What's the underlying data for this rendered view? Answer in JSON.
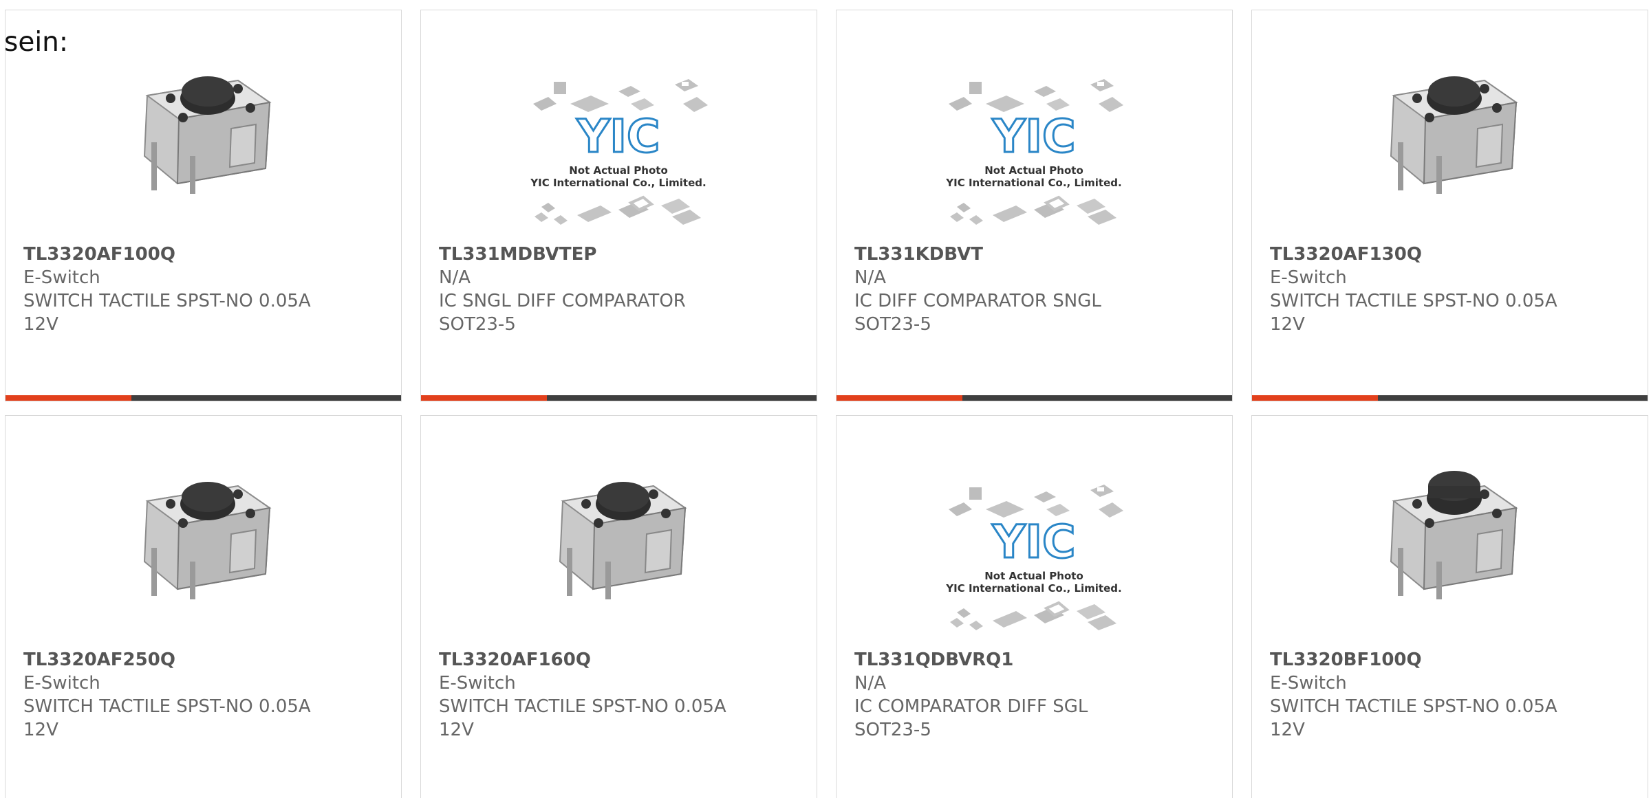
{
  "intro_text": "sein:",
  "products": [
    {
      "part_number": "TL3320AF100Q",
      "manufacturer": "E-Switch",
      "description": "SWITCH TACTILE SPST-NO 0.05A 12V",
      "image": "tactile-switch-photo"
    },
    {
      "part_number": "TL331MDBVTEP",
      "manufacturer": "N/A",
      "description": "IC SNGL DIFF COMPARATOR SOT23-5",
      "image": "not-actual-photo-placeholder",
      "placeholder_caption_1": "Not Actual Photo",
      "placeholder_caption_2": "YIC International Co., Limited.",
      "placeholder_logo": "YIC"
    },
    {
      "part_number": "TL331KDBVT",
      "manufacturer": "N/A",
      "description": "IC DIFF COMPARATOR SNGL SOT23-5",
      "image": "not-actual-photo-placeholder",
      "placeholder_caption_1": "Not Actual Photo",
      "placeholder_caption_2": "YIC International Co., Limited.",
      "placeholder_logo": "YIC"
    },
    {
      "part_number": "TL3320AF130Q",
      "manufacturer": "E-Switch",
      "description": "SWITCH TACTILE SPST-NO 0.05A 12V",
      "image": "tactile-switch-photo"
    },
    {
      "part_number": "TL3320AF250Q",
      "manufacturer": "E-Switch",
      "description": "SWITCH TACTILE SPST-NO 0.05A 12V",
      "image": "tactile-switch-photo"
    },
    {
      "part_number": "TL3320AF160Q",
      "manufacturer": "E-Switch",
      "description": "SWITCH TACTILE SPST-NO 0.05A 12V",
      "image": "tactile-switch-photo"
    },
    {
      "part_number": "TL331QDBVRQ1",
      "manufacturer": "N/A",
      "description": "IC COMPARATOR DIFF SGL SOT23-5",
      "image": "not-actual-photo-placeholder",
      "placeholder_caption_1": "Not Actual Photo",
      "placeholder_caption_2": "YIC International Co., Limited.",
      "placeholder_logo": "YIC"
    },
    {
      "part_number": "TL3320BF100Q",
      "manufacturer": "E-Switch",
      "description": "SWITCH TACTILE SPST-NO 0.05A 12V",
      "image": "tactile-switch-photo"
    }
  ],
  "colors": {
    "accent_bar": "#e2401c",
    "dark_bar": "#3f3f3f",
    "text": "#666666",
    "part_number": "#555555",
    "logo_blue": "#2a86c7"
  }
}
